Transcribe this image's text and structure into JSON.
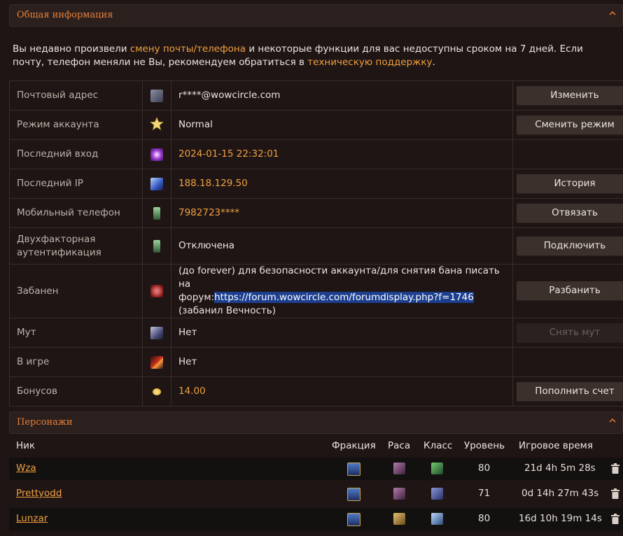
{
  "general": {
    "title": "Общая информация",
    "notice": {
      "part1": "Вы недавно произвели ",
      "link1": "смену почты/телефона",
      "part2": " и некоторые функции для вас недоступны сроком на 7 дней. Если почту, телефон меняли не Вы, рекомендуем обратиться в ",
      "link2": "техническую поддержку",
      "part3": "."
    },
    "rows": [
      {
        "label": "Почтовый адрес",
        "icon": "mail-crest-icon",
        "value": "r****@wowcircle.com",
        "button": "Изменить"
      },
      {
        "label": "Режим аккаунта",
        "icon": "star-icon",
        "value": "Normal",
        "button": "Сменить режим"
      },
      {
        "label": "Последний вход",
        "icon": "portal-icon",
        "value": "2024-01-15 22:32:01",
        "button": ""
      },
      {
        "label": "Последний IP",
        "icon": "network-icon",
        "value": "188.18.129.50",
        "button": "История"
      },
      {
        "label": "Мобильный телефон",
        "icon": "phone-icon",
        "value": "7982723****",
        "button": "Отвязать"
      },
      {
        "label_line1": "Двухфакторная",
        "label_line2": "аутентификация",
        "icon": "phone-icon",
        "value": "Отключена",
        "button": "Подключить"
      },
      {
        "label": "Забанен",
        "icon": "banned-hand-icon",
        "value_line1": "(до forever) для безопасности аккаунта/для снятия бана писать на",
        "value_prefix": "форум:",
        "value_link": "https://forum.wowcircle.com/forumdisplay.php?f=1746",
        "value_line3": "(забанил Вечность)",
        "button": "Разбанить"
      },
      {
        "label": "Мут",
        "icon": "muted-eye-icon",
        "value": "Нет",
        "button": "Снять мут"
      },
      {
        "label": "В игре",
        "icon": "fire-slash-icon",
        "value": "Нет",
        "button": ""
      },
      {
        "label": "Бонусов",
        "icon": "coins-icon",
        "value": "14.00",
        "button": "Пополнить счет"
      }
    ]
  },
  "characters": {
    "title": "Персонажи",
    "columns": [
      "Ник",
      "Фракция",
      "Раса",
      "Класс",
      "Уровень",
      "Игровое время"
    ],
    "rows": [
      {
        "name": "Wza",
        "level": "80",
        "time": "21d 4h 5m 28s"
      },
      {
        "name": "Prettyodd",
        "level": "71",
        "time": "0d 14h 27m 43s"
      },
      {
        "name": "Lunzar",
        "level": "80",
        "time": "16d 10h 19m 14s"
      }
    ]
  },
  "colors": {
    "accent": "#e8803a",
    "link": "#f0a040",
    "background": "#1e1514"
  }
}
